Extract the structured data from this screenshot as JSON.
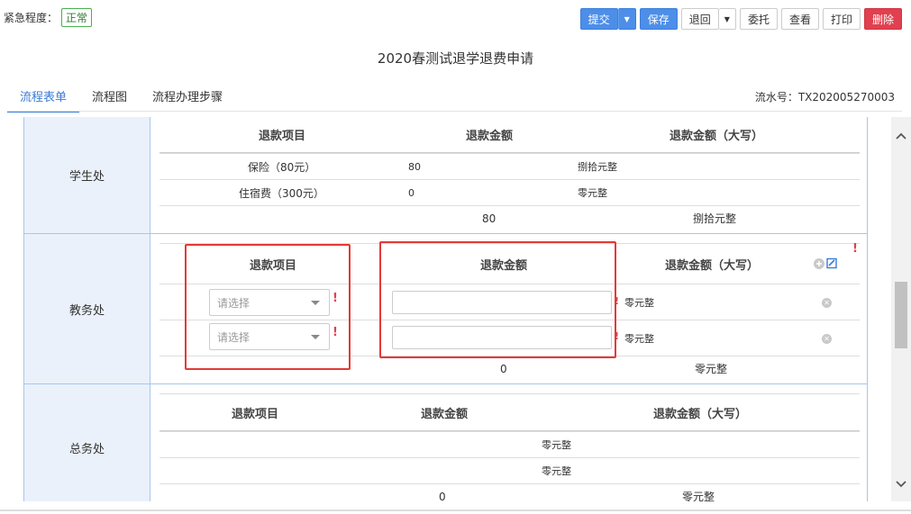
{
  "header": {
    "urgency_label": "紧急程度：",
    "urgency_value": "正常",
    "buttons": {
      "submit": "提交",
      "save": "保存",
      "return": "退回",
      "delegate": "委托",
      "view": "查看",
      "print": "打印",
      "delete": "删除"
    }
  },
  "title": "2020春测试退学退费申请",
  "tabs": [
    "流程表单",
    "流程图",
    "流程办理步骤"
  ],
  "serial": "流水号：TX202005270003",
  "columns": {
    "item": "退款项目",
    "amount": "退款金额",
    "amount_upper": "退款金额（大写）"
  },
  "sections": {
    "student": {
      "name": "学生处",
      "rows": [
        {
          "item": "保险（80元）",
          "amount": "80",
          "upper": "捌拾元整"
        },
        {
          "item": "住宿费（300元）",
          "amount": "0",
          "upper": "零元整"
        }
      ],
      "total_amount": "80",
      "total_upper": "捌拾元整"
    },
    "academic": {
      "name": "教务处",
      "placeholder": "请选择",
      "required_mark": "!",
      "rows": [
        {
          "upper": "零元整"
        },
        {
          "upper": "零元整"
        }
      ],
      "total_amount": "0",
      "total_upper": "零元整"
    },
    "general": {
      "name": "总务处",
      "rows": [
        {
          "upper": "零元整"
        },
        {
          "upper": "零元整"
        }
      ],
      "total_amount": "0",
      "total_upper": "零元整"
    }
  },
  "icons": {
    "caret": "caret-down-icon",
    "add": "plus-circle-icon",
    "edit": "edit-icon",
    "remove": "remove-circle-icon",
    "scroll_up": "chevron-up-icon",
    "scroll_down": "chevron-down-icon"
  },
  "colors": {
    "primary": "#4d8ee8",
    "danger": "#e0404f",
    "highlight_box": "#e53935",
    "dept_bg": "#eaf1fb",
    "urgency_badge": "#4caf50"
  }
}
